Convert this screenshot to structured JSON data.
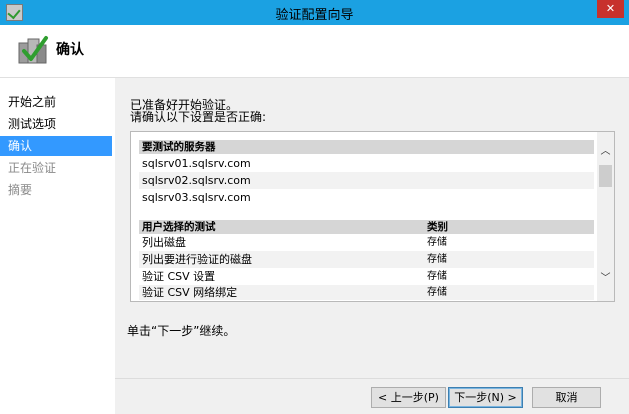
{
  "window": {
    "title": "验证配置向导",
    "close_glyph": "✕"
  },
  "header": {
    "title": "确认"
  },
  "sidebar": {
    "items": [
      {
        "label": "开始之前",
        "state": "normal"
      },
      {
        "label": "测试选项",
        "state": "normal"
      },
      {
        "label": "确认",
        "state": "active"
      },
      {
        "label": "正在验证",
        "state": "disabled"
      },
      {
        "label": "摘要",
        "state": "disabled"
      }
    ]
  },
  "content": {
    "intro_line1": "已准备好开始验证。",
    "intro_line2": "请确认以下设置是否正确:",
    "servers_header": "要测试的服务器",
    "servers": [
      "sqlsrv01.sqlsrv.com",
      "sqlsrv02.sqlsrv.com",
      "sqlsrv03.sqlsrv.com"
    ],
    "tests_header": "用户选择的测试",
    "category_header": "类别",
    "tests": [
      {
        "name": "列出磁盘",
        "category": "存储"
      },
      {
        "name": "列出要进行验证的磁盘",
        "category": "存储"
      },
      {
        "name": "验证 CSV 设置",
        "category": "存储"
      },
      {
        "name": "验证 CSV 网络绑定",
        "category": "存储"
      }
    ],
    "continue_text": "单击“下一步”继续。",
    "scroll_up_glyph": "︿",
    "scroll_down_glyph": "﹀"
  },
  "footer": {
    "prev_label": "< 上一步(P)",
    "next_label": "下一步(N) >",
    "cancel_label": "取消"
  },
  "colors": {
    "titlebar": "#1ba1e2",
    "active_item": "#3399ff",
    "close": "#c7312c"
  }
}
